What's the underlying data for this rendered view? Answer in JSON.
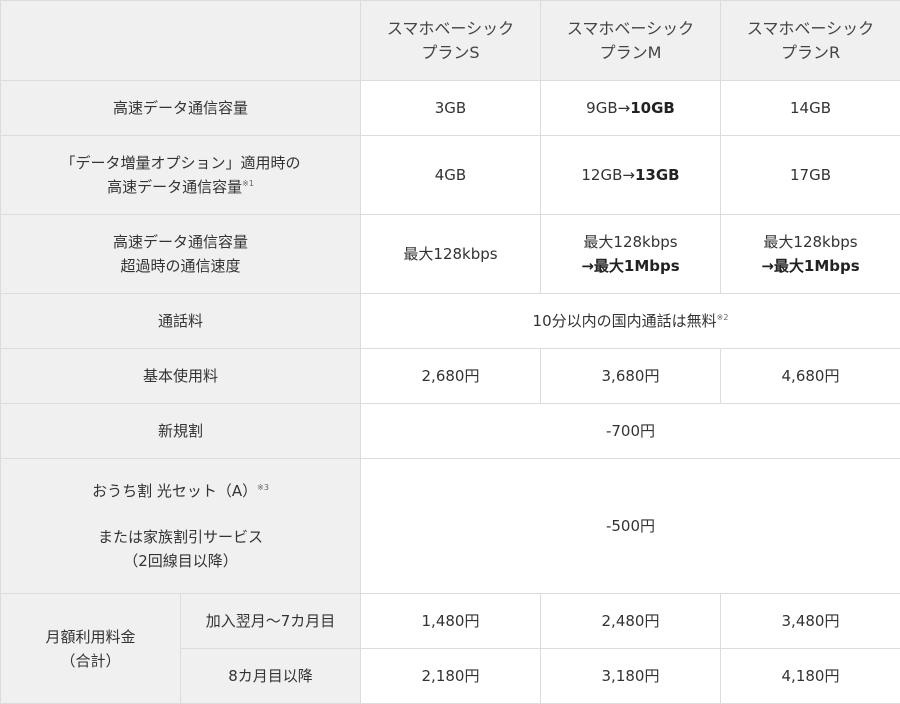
{
  "plans": [
    {
      "name_line1": "スマホベーシック",
      "name_line2": "プランS"
    },
    {
      "name_line1": "スマホベーシック",
      "name_line2": "プランM"
    },
    {
      "name_line1": "スマホベーシック",
      "name_line2": "プランR"
    }
  ],
  "rows": {
    "capacity": {
      "label": "高速データ通信容量",
      "s": "3GB",
      "m_old": "9GB→",
      "m_new": "10GB",
      "r": "14GB"
    },
    "option": {
      "label_line1": "「データ増量オプション」適用時の",
      "label_line2": "高速データ通信容量",
      "note": "※1",
      "s": "4GB",
      "m_old": "12GB→",
      "m_new": "13GB",
      "r": "17GB"
    },
    "speed": {
      "label_line1": "高速データ通信容量",
      "label_line2": "超過時の通信速度",
      "s": "最大128kbps",
      "m_line1": "最大128kbps",
      "m_line2": "→最大1Mbps",
      "r_line1": "最大128kbps",
      "r_line2": "→最大1Mbps"
    },
    "call": {
      "label": "通話料",
      "value": "10分以内の国内通話は無料",
      "note": "※2"
    },
    "base_fee": {
      "label": "基本使用料",
      "s": "2,680円",
      "m": "3,680円",
      "r": "4,680円"
    },
    "new_discount": {
      "label": "新規割",
      "value": "-700円"
    },
    "home_discount": {
      "note": "※3",
      "label_line1": "おうち割 光セット（A）",
      "label_line2": "または家族割引サービス",
      "label_line3": "（2回線目以降）",
      "value": "-500円"
    },
    "monthly": {
      "label_line1": "月額利用料金",
      "label_line2": "（合計）",
      "period1": {
        "label": "加入翌月～7カ月目",
        "s": "1,480円",
        "m": "2,480円",
        "r": "3,480円"
      },
      "period2": {
        "label": "8カ月目以降",
        "s": "2,180円",
        "m": "3,180円",
        "r": "4,180円"
      }
    }
  },
  "colors": {
    "label_bg": "#f0f0f0",
    "value_bg": "#ffffff",
    "border": "#dcdcdc",
    "text": "#333333"
  }
}
